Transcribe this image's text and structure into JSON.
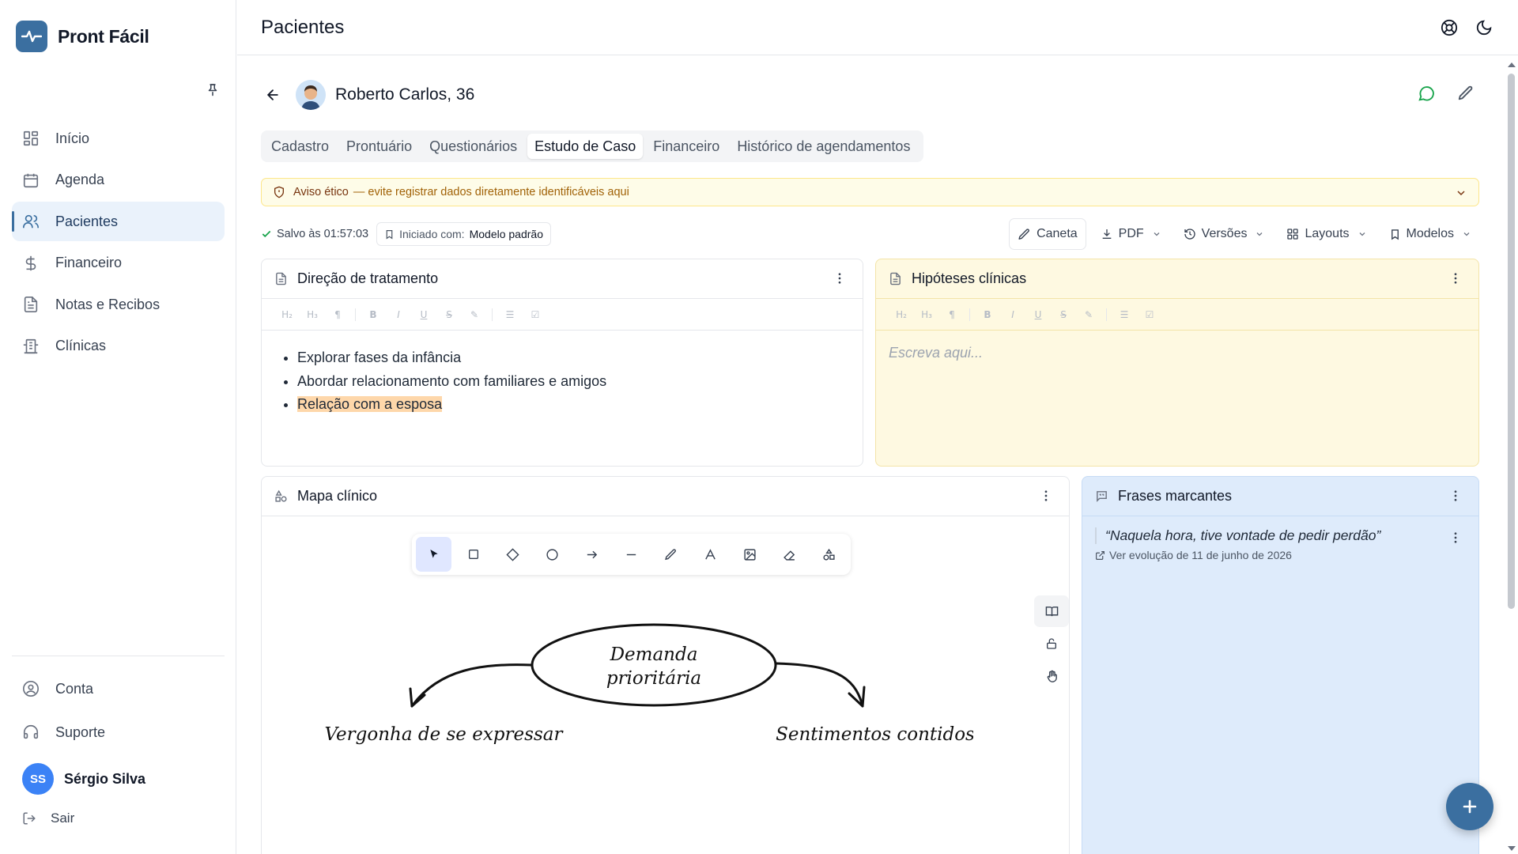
{
  "brand": {
    "name": "Pront Fácil"
  },
  "sidebar": {
    "items": [
      {
        "label": "Início",
        "icon": "grid-icon"
      },
      {
        "label": "Agenda",
        "icon": "calendar-icon"
      },
      {
        "label": "Pacientes",
        "icon": "users-icon",
        "active": true
      },
      {
        "label": "Financeiro",
        "icon": "dollar-icon"
      },
      {
        "label": "Notas e Recibos",
        "icon": "document-icon"
      },
      {
        "label": "Clínicas",
        "icon": "building-icon"
      }
    ],
    "bottom": [
      {
        "label": "Conta",
        "icon": "user-circle-icon"
      },
      {
        "label": "Suporte",
        "icon": "headset-icon"
      }
    ],
    "user": {
      "initials": "SS",
      "name": "Sérgio Silva"
    },
    "logout": "Sair"
  },
  "topbar": {
    "title": "Pacientes"
  },
  "patient": {
    "name": "Roberto Carlos, 36"
  },
  "tabs": [
    {
      "label": "Cadastro"
    },
    {
      "label": "Prontuário"
    },
    {
      "label": "Questionários"
    },
    {
      "label": "Estudo de Caso",
      "active": true
    },
    {
      "label": "Financeiro"
    },
    {
      "label": "Histórico de agendamentos"
    }
  ],
  "alert": {
    "title": "Aviso ético",
    "text": "— evite registrar dados diretamente identificáveis aqui"
  },
  "status": {
    "saved": "Salvo às 01:57:03",
    "started_label": "Iniciado com:",
    "started_value": "Modelo padrão"
  },
  "toolbar": {
    "pen": "Caneta",
    "pdf": "PDF",
    "versions": "Versões",
    "layouts": "Layouts",
    "models": "Modelos"
  },
  "cards": {
    "treatment": {
      "title": "Direção de tratamento",
      "items": [
        "Explorar fases da infância",
        "Abordar relacionamento com familiares e amigos",
        "Relação com a esposa"
      ]
    },
    "hypotheses": {
      "title": "Hipóteses clínicas",
      "placeholder": "Escreva aqui..."
    },
    "map": {
      "title": "Mapa clínico",
      "center": [
        "Demanda",
        "prioritária"
      ],
      "left": "Vergonha de se expressar",
      "right": "Sentimentos contidos"
    },
    "phrases": {
      "title": "Frases marcantes",
      "quote": "“Naquela hora, tive vontade de pedir perdão”",
      "link": "Ver evolução de 11 de junho de 2026"
    }
  },
  "format_bar": {
    "h2": "H₂",
    "h3": "H₃"
  },
  "colors": {
    "accent": "#3b6fa0",
    "active_nav_bg": "#eaf2fb",
    "hypotheses_bg": "#fef9e1",
    "phrases_bg": "#deebfb",
    "alert_bg": "#fefce8",
    "highlight": "#fed7aa"
  }
}
